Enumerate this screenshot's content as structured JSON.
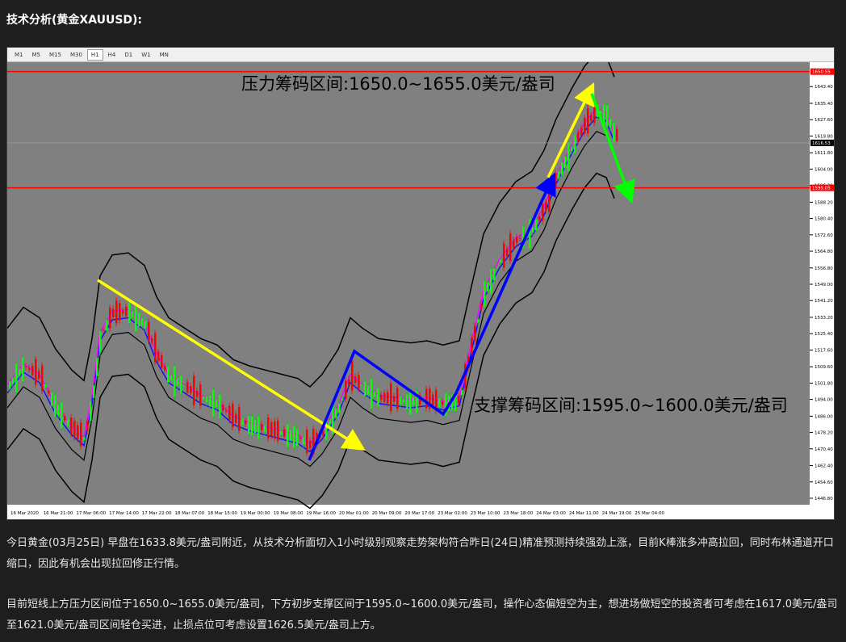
{
  "page_title": "技术分析(黄金XAUUSD):",
  "timeframes": [
    "M1",
    "M5",
    "M15",
    "M30",
    "H1",
    "H4",
    "D1",
    "W1",
    "MN"
  ],
  "active_timeframe": "H1",
  "annotations": {
    "resistance": "压力筹码区间:1650.0~1655.0美元/盎司",
    "support": "支撑筹码区间:1595.0~1600.0美元/盎司"
  },
  "price_tags": {
    "upper_line": "1650.55",
    "current": "1616.53",
    "lower_line": "1595.05"
  },
  "colors": {
    "background": "#808080",
    "resistance_line": "#ff0000",
    "trend_yellow": "#ffff00",
    "trend_blue": "#0000ff",
    "trend_green": "#00ff00",
    "bollinger": "#000000"
  },
  "chart_data": {
    "type": "line",
    "y_ticks": [
      "1643.40",
      "1635.40",
      "1627.60",
      "1619.80",
      "1611.80",
      "1604.00",
      "1596.20",
      "1588.20",
      "1580.40",
      "1572.60",
      "1564.80",
      "1556.80",
      "1549.00",
      "1541.20",
      "1533.20",
      "1525.40",
      "1517.60",
      "1509.60",
      "1501.80",
      "1494.00",
      "1486.00",
      "1478.20",
      "1470.40",
      "1462.40",
      "1454.60",
      "1446.80"
    ],
    "x_ticks": [
      "16 Mar 2020",
      "16 Mar 21:00",
      "17 Mar 06:00",
      "17 Mar 14:00",
      "17 Mar 22:00",
      "18 Mar 07:00",
      "18 Mar 15:00",
      "19 Mar 00:00",
      "19 Mar 08:00",
      "19 Mar 16:00",
      "20 Mar 01:00",
      "20 Mar 09:00",
      "20 Mar 17:00",
      "23 Mar 02:00",
      "23 Mar 10:00",
      "23 Mar 18:00",
      "24 Mar 03:00",
      "24 Mar 11:00",
      "24 Mar 19:00",
      "25 Mar 04:00"
    ],
    "horizontal_levels": [
      1650.55,
      1595.05
    ],
    "current_price": 1616.53,
    "ylim": [
      1446.8,
      1651.2
    ]
  },
  "paragraphs": [
    "今日黄金(03月25日) 早盘在1633.8美元/盎司附近，从技术分析面切入1小时级别观察走势架构符合昨日(24日)精准预测持续强劲上涨，目前K棒涨多冲高拉回，同时布林通道开口缩口，因此有机会出现拉回修正行情。",
    "目前短线上方压力区间位于1650.0~1655.0美元/盎司，下方初步支撑区间于1595.0~1600.0美元/盎司，操作心态偏短空为主，想进场做短空的投资者可考虑在1617.0美元/盎司至1621.0美元/盎司区间轻仓买进，止损点位可考虑设置1626.5美元/盎司上方。"
  ]
}
